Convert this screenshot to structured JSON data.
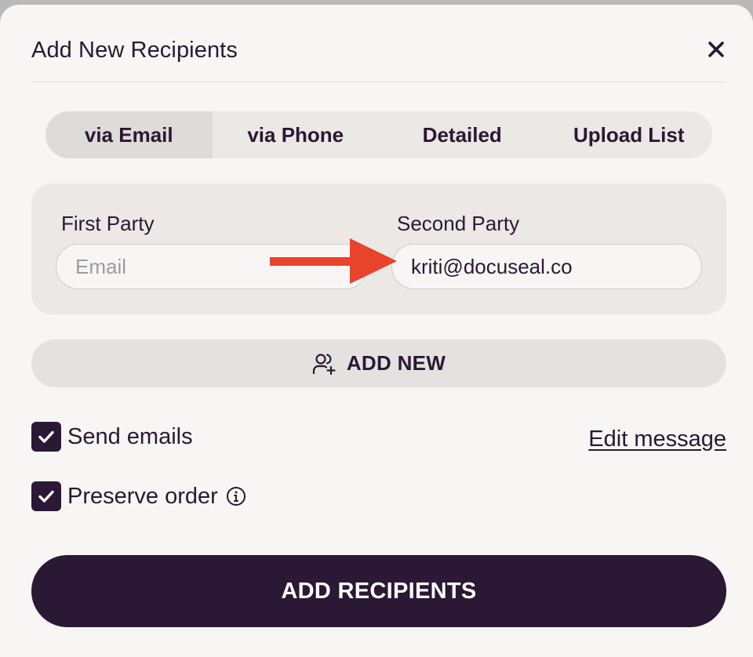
{
  "dialog": {
    "title": "Add New Recipients"
  },
  "tabs": [
    {
      "label": "via Email",
      "active": true
    },
    {
      "label": "via Phone",
      "active": false
    },
    {
      "label": "Detailed",
      "active": false
    },
    {
      "label": "Upload List",
      "active": false
    }
  ],
  "parties": [
    {
      "label": "First Party",
      "value": "",
      "placeholder": "Email"
    },
    {
      "label": "Second Party",
      "value": "kriti@docuseal.co",
      "placeholder": "Email"
    }
  ],
  "add_new": {
    "label": "ADD NEW",
    "icon": "user-plus-icon"
  },
  "options": {
    "send_emails": {
      "label": "Send emails",
      "checked": true
    },
    "edit_message": "Edit message",
    "preserve_order": {
      "label": "Preserve order",
      "checked": true,
      "info_icon": "info-icon"
    }
  },
  "submit": {
    "label": "ADD RECIPIENTS"
  },
  "colors": {
    "primary": "#2a1834",
    "background": "#f8f6f4",
    "panel": "#ebe8e5",
    "annotation_arrow": "#e8432b"
  }
}
